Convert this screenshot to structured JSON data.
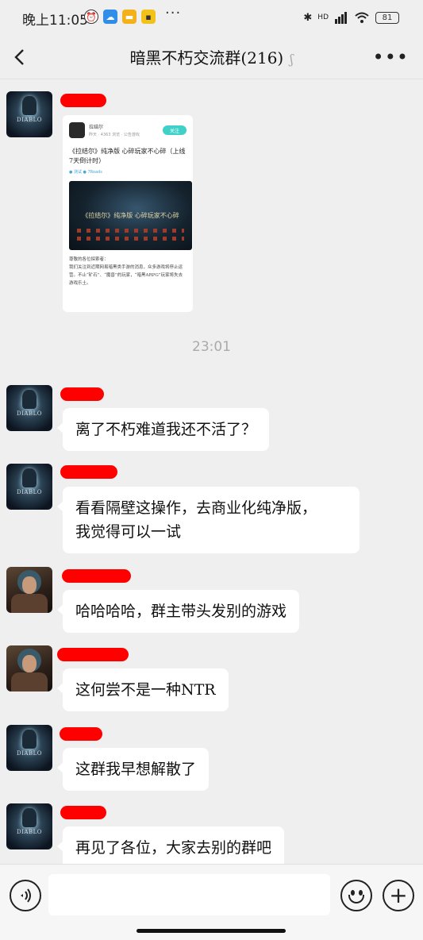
{
  "status_bar": {
    "time": "晚上11:05",
    "more": "···",
    "network": "HD",
    "battery": "81"
  },
  "header": {
    "title": "暗黑不朽交流群(216)"
  },
  "article_card": {
    "author": "拉结尔",
    "sub": "昨天 · 4363 浏览 · 公告游戏",
    "follow": "关注",
    "title": "《拉结尔》纯净版 心碎玩家不心碎（上线7天倒计时）",
    "tags": "● 测试   ● 7Roads",
    "image_banner": "《拉结尔》纯净版 心碎玩家不心碎",
    "body": "尊敬的各位探索者：\n我们关注到近期网易暗黑类手游的消息，众多游戏将停止运营。不止“矿石”、“魔兽”的玩家，“暗黑ARPG”玩家将失去游戏乐土。"
  },
  "timestamp": "23:01",
  "messages": [
    {
      "text": "离了不朽难道我还不活了？"
    },
    {
      "text": "看看隔壁这操作，去商业化纯净版，\n我觉得可以一试"
    },
    {
      "text": "哈哈哈哈，群主带头发别的游戏"
    },
    {
      "text": "这何尝不是一种NTR"
    },
    {
      "text": "这群我早想解散了"
    },
    {
      "text": "再见了各位，大家去别的群吧"
    }
  ],
  "avatars": {
    "diablo_label": "DIABLO"
  },
  "input": {
    "placeholder": "",
    "plus": "+"
  }
}
